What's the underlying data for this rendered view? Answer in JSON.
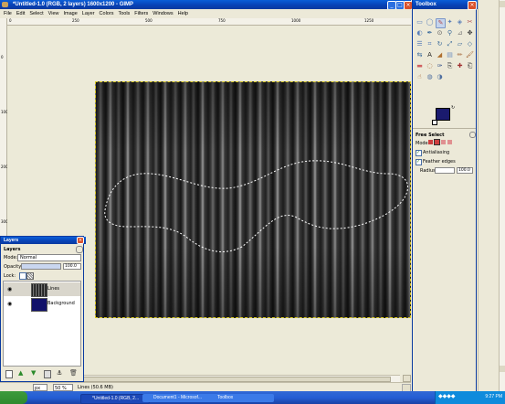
{
  "window": {
    "title": "*Untitled-1.0 (RGB, 2 layers) 1600x1200 - GIMP",
    "menu": [
      "File",
      "Edit",
      "Select",
      "View",
      "Image",
      "Layer",
      "Colors",
      "Tools",
      "Filters",
      "Windows",
      "Help"
    ]
  },
  "ruler_top": [
    "0",
    "250",
    "500",
    "750",
    "1000",
    "1250"
  ],
  "ruler_left": [
    "0",
    "100",
    "200",
    "300",
    "400"
  ],
  "layers_dialog": {
    "title": "Layers",
    "header": "Layers",
    "mode_label": "Mode:",
    "mode_value": "Normal",
    "opacity_label": "Opacity:",
    "opacity_value": "100.0",
    "lock_label": "Lock:",
    "layers": [
      {
        "name": "Lines"
      },
      {
        "name": "Background"
      }
    ]
  },
  "toolbox": {
    "title": "Toolbox",
    "colors": {
      "foreground": "#1a1a6e",
      "background": "#111111"
    },
    "options": {
      "title": "Free Select",
      "mode_label": "Mode:",
      "antialiasing": "Antialiasing",
      "feather": "Feather edges",
      "radius_label": "Radius:",
      "radius_value": "100.0"
    }
  },
  "statusbar": {
    "unit": "px",
    "zoom": "50 %",
    "message": "Lines (50.6 MB)"
  },
  "taskbar": {
    "tasks": [
      "*Untitled-1.0 (RGB, 2...",
      "Document1 - Microsof...",
      "Toolbox"
    ],
    "clock": "9:27 PM"
  }
}
